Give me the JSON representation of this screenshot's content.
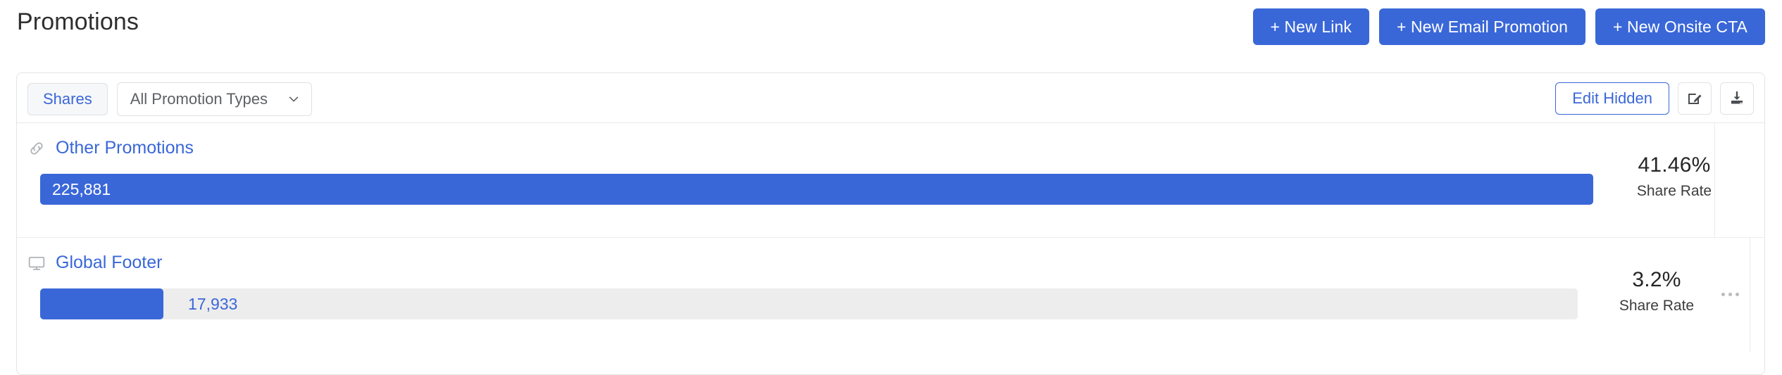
{
  "header": {
    "title": "Promotions",
    "actions": [
      {
        "label": "+ New Link",
        "name": "new-link-button"
      },
      {
        "label": "+ New Email Promotion",
        "name": "new-email-promotion-button"
      },
      {
        "label": "+ New Onsite CTA",
        "name": "new-onsite-cta-button"
      }
    ]
  },
  "toolbar": {
    "metric_toggle_label": "Shares",
    "promotion_type_filter": {
      "selected": "All Promotion Types",
      "icon": "chevron-down-icon"
    },
    "edit_hidden_label": "Edit Hidden",
    "edit_icon": "edit-square-icon",
    "download_icon": "download-icon"
  },
  "rows": [
    {
      "name": "Other Promotions",
      "icon": "link-icon",
      "value": "225,881",
      "value_position": "inside",
      "bar_pct": 100,
      "stat_value": "41.46%",
      "stat_label": "Share Rate",
      "has_kebab": false
    },
    {
      "name": "Global Footer",
      "icon": "monitor-icon",
      "value": "17,933",
      "value_position": "outside",
      "bar_pct": 7.9,
      "stat_value": "3.2%",
      "stat_label": "Share Rate",
      "has_kebab": true
    }
  ],
  "colors": {
    "accent_blue": "#3A67D8",
    "bar_track_gray": "#ededed",
    "text_dark": "#262626"
  },
  "chart_data": {
    "type": "bar",
    "title": "Promotions",
    "orientation": "horizontal",
    "metric": "Shares",
    "categories": [
      "Other Promotions",
      "Global Footer"
    ],
    "values": [
      225881,
      17933
    ],
    "value_labels": [
      "225,881",
      "17,933"
    ],
    "secondary_metric": "Share Rate",
    "secondary_values": [
      "41.46%",
      "3.2%"
    ],
    "xlabel": "",
    "ylabel": "",
    "grid": false,
    "legend": "none"
  }
}
